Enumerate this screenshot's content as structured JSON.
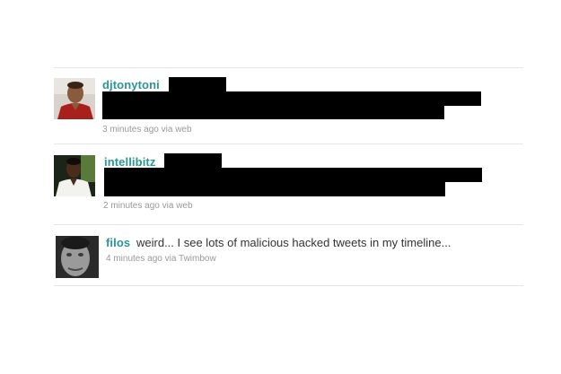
{
  "tweets": [
    {
      "username": "djtonytoni",
      "text": "",
      "time": "3 minutes ago",
      "via_word": "via",
      "source": "web",
      "redacted": true
    },
    {
      "username": "intellibitz",
      "text": "",
      "time": "2 minutes ago",
      "via_word": "via",
      "source": "web",
      "redacted": true
    },
    {
      "username": "filos",
      "text": "weird... I see lots of malicious hacked tweets in my timeline...",
      "time": "4 minutes ago",
      "via_word": "via",
      "source": "Twimbow",
      "redacted": false
    }
  ],
  "colors": {
    "username": "#2a9696",
    "meta": "#999999",
    "divider": "#e6e6e6",
    "redaction": "#000000"
  }
}
